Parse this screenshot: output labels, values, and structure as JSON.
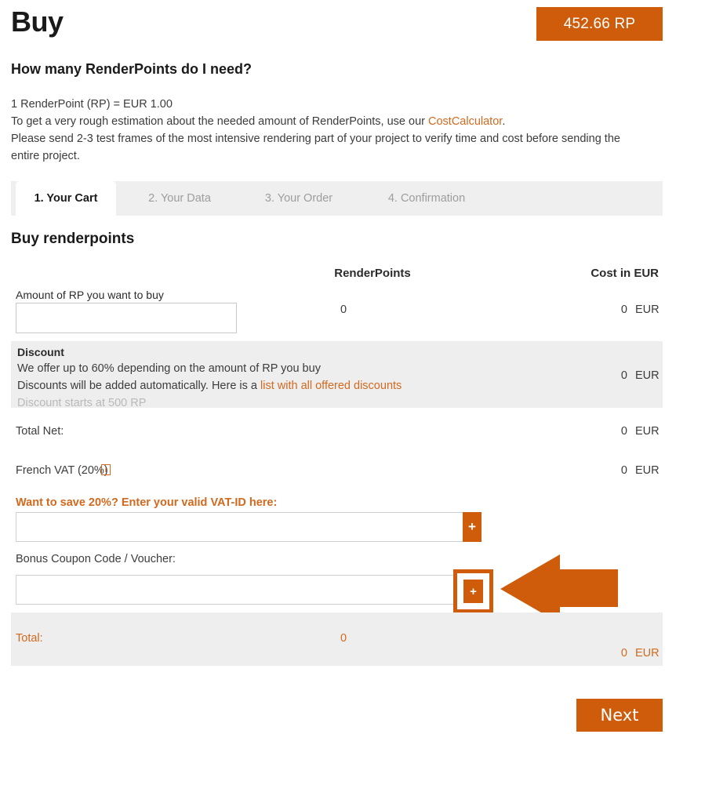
{
  "colors": {
    "accent": "#cf5c0a",
    "link": "#d2691e",
    "panel_bg": "#eeeeee",
    "tabbar_bg": "#efefef",
    "muted_text": "#b9b9b9"
  },
  "header": {
    "title": "Buy",
    "rp_badge": "452.66 RP"
  },
  "intro": {
    "subtitle": "How many RenderPoints do I need?",
    "line1": "1 RenderPoint (RP) = EUR 1.00",
    "line2_before": "To get a very rough estimation about the needed amount of RenderPoints, use our ",
    "line2_link": "CostCalculator",
    "line2_after": ".",
    "line3": "Please send 2-3 test frames of the most intensive rendering part of your project to verify time and cost before sending the entire project."
  },
  "tabs": [
    {
      "label": "1. Your Cart",
      "active": true
    },
    {
      "label": "2. Your Data",
      "active": false
    },
    {
      "label": "3. Your Order",
      "active": false
    },
    {
      "label": "4. Confirmation",
      "active": false
    }
  ],
  "cart": {
    "section_title": "Buy renderpoints",
    "columns": {
      "renderpoints": "RenderPoints",
      "cost": "Cost in EUR"
    },
    "amount_row": {
      "label": "Amount of RP you want to buy",
      "input_value": "",
      "input_placeholder": "",
      "renderpoints": "0",
      "cost": "0",
      "currency": "EUR"
    },
    "discount": {
      "title": "Discount",
      "line1": "We offer up to 60% depending on the amount of RP you buy",
      "line2_before": "Discounts will be added automatically. Here is a ",
      "line2_link": "list with all offered discounts",
      "line3": "Discount starts at 500 RP",
      "cost": "0",
      "currency": "EUR"
    },
    "total_net": {
      "label": "Total Net:",
      "cost": "0",
      "currency": "EUR"
    },
    "vat": {
      "label": "French VAT (20%)",
      "info_icon": "i",
      "cost": "0",
      "currency": "EUR"
    },
    "vat_id": {
      "label": "Want to save 20%? Enter your valid VAT-ID here:",
      "input_value": "",
      "input_placeholder": "",
      "add_button": "+"
    },
    "coupon": {
      "label": "Bonus Coupon Code / Voucher:",
      "input_value": "",
      "input_placeholder": "",
      "add_button": "+"
    },
    "total": {
      "label": "Total:",
      "renderpoints": "0",
      "cost": "0",
      "currency": "EUR"
    },
    "next_button": "Next"
  },
  "annotation": {
    "arrow": "left-pointing-arrow",
    "highlight_target": "coupon-add-button"
  }
}
